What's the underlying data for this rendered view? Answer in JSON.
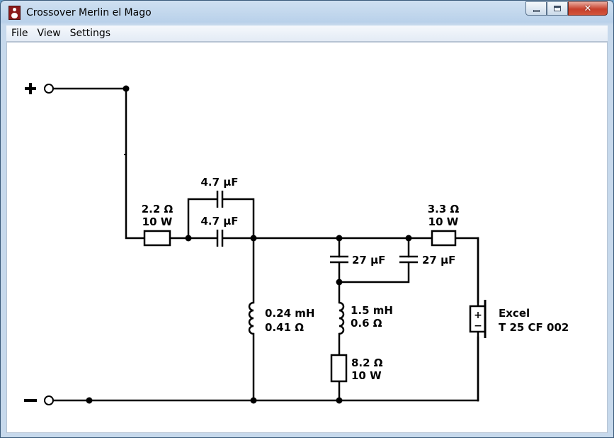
{
  "window": {
    "title": "Crossover Merlin el Mago",
    "controls": {
      "minimize": "minimize",
      "maximize": "maximize",
      "close": "close"
    }
  },
  "menu": {
    "file": "File",
    "view": "View",
    "settings": "Settings"
  },
  "schematic": {
    "terminal_plus": "+",
    "terminal_minus": "−",
    "r1": {
      "value": "2.2 Ω",
      "power": "10 W"
    },
    "c_top": {
      "value": "4.7 µF"
    },
    "c_main": {
      "value": "4.7 µF"
    },
    "c_left": {
      "value": "27 µF"
    },
    "c_right": {
      "value": "27 µF"
    },
    "l1": {
      "value": "0.24 mH",
      "resistance": "0.41 Ω"
    },
    "l2": {
      "value": "1.5 mH",
      "resistance": "0.6 Ω"
    },
    "r2": {
      "value": "8.2 Ω",
      "power": "10 W"
    },
    "r3": {
      "value": "3.3 Ω",
      "power": "10 W"
    },
    "speaker": {
      "brand": "Excel",
      "model": "T 25 CF 002",
      "plus": "+",
      "minus": "−"
    }
  }
}
